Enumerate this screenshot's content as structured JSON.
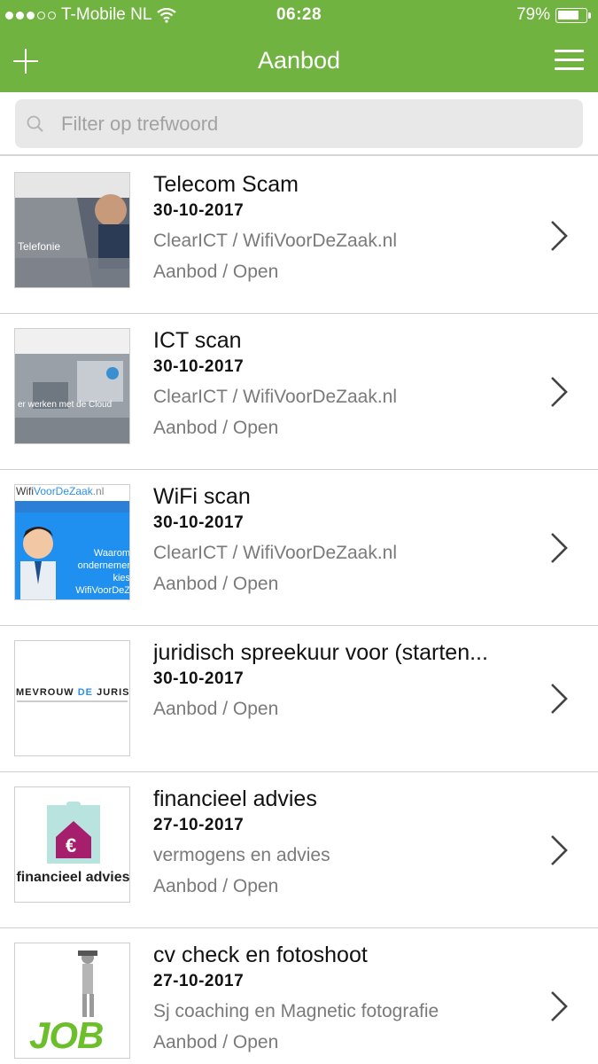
{
  "status_bar": {
    "carrier": "T-Mobile NL",
    "time": "06:28",
    "battery_text": "79%",
    "battery_level": 0.79,
    "signal_bars_filled": 3,
    "signal_bars_total": 5
  },
  "nav": {
    "title": "Aanbod",
    "left_icon": "plus-icon",
    "right_icon": "hamburger-menu-icon",
    "bg_color": "#71b340"
  },
  "search": {
    "placeholder": "Filter op trefwoord",
    "value": "",
    "icon": "search-icon"
  },
  "items": [
    {
      "title": "Telecom Scam",
      "date": "30-10-2017",
      "subtitle": "ClearICT / WifiVoorDeZaak.nl",
      "status": "Aanbod / Open",
      "thumb_text": "Telefonie"
    },
    {
      "title": "ICT scan",
      "date": "30-10-2017",
      "subtitle": "ClearICT / WifiVoorDeZaak.nl",
      "status": "Aanbod / Open",
      "thumb_text": "er werken met de Cloud"
    },
    {
      "title": "WiFi scan",
      "date": "30-10-2017",
      "subtitle": "ClearICT / WifiVoorDeZaak.nl",
      "status": "Aanbod / Open",
      "thumb_logo_a": "Wifi",
      "thumb_logo_b": "VoorDeZaak",
      "thumb_logo_c": ".nl",
      "thumb_text": "Waarom ondernemer kies WifiVoorDeZ"
    },
    {
      "title": "juridisch spreekuur voor (starten...",
      "date": "30-10-2017",
      "subtitle": "",
      "status": "Aanbod / Open",
      "thumb_logo_a": "MEVROUW ",
      "thumb_logo_b": "DE",
      "thumb_logo_c": " JURISTE"
    },
    {
      "title": "financieel advies",
      "date": "27-10-2017",
      "subtitle": "vermogens en advies",
      "status": "Aanbod / Open",
      "thumb_text": "financieel advies",
      "thumb_symbol": "€"
    },
    {
      "title": "cv check en fotoshoot",
      "date": "27-10-2017",
      "subtitle": "Sj coaching en Magnetic fotografie",
      "status": "Aanbod / Open",
      "thumb_text": "JOB"
    }
  ]
}
